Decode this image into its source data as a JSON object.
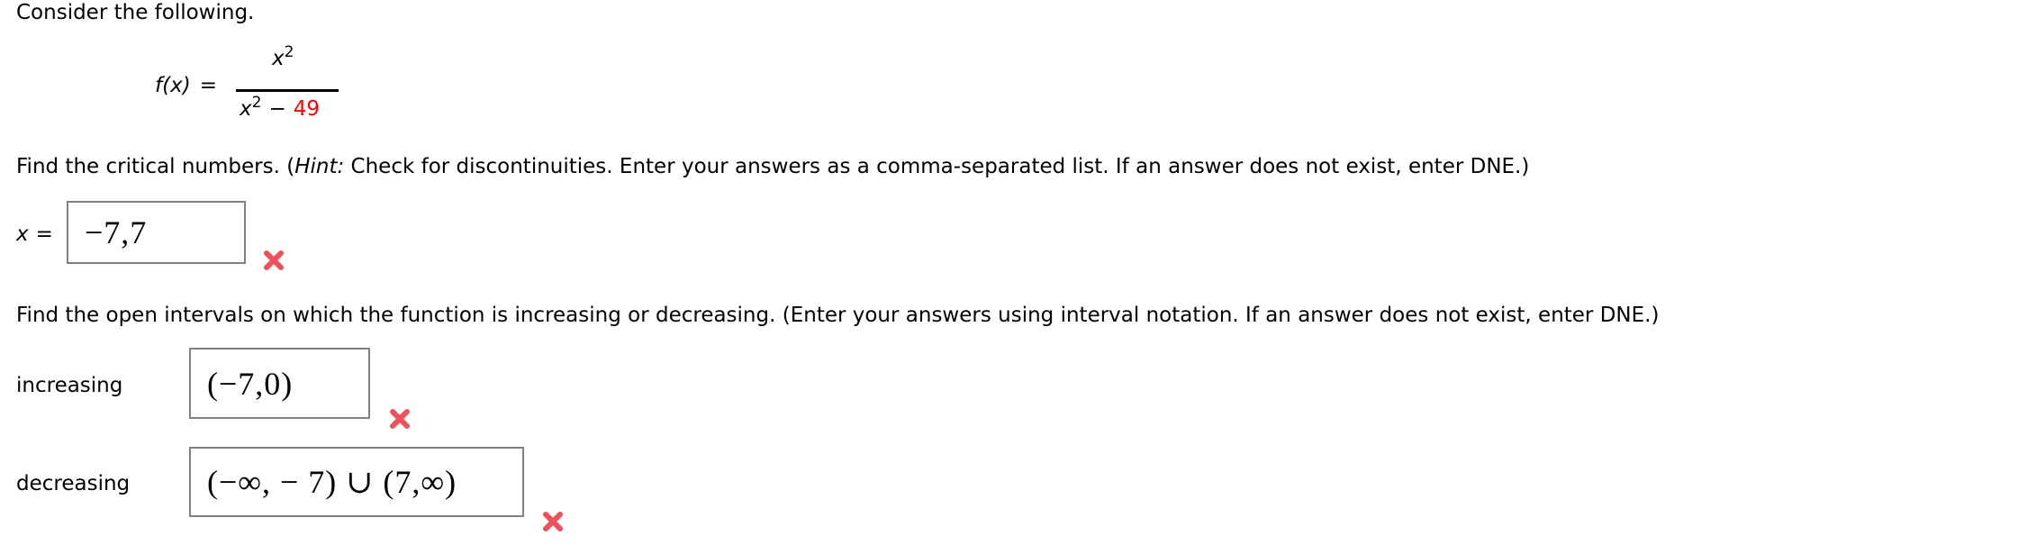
{
  "intro": "Consider the following.",
  "function": {
    "lhs_name": "f",
    "lhs_var": "x",
    "equals": "=",
    "numerator_var": "x",
    "numerator_exp": "2",
    "denominator_var": "x",
    "denominator_exp": "2",
    "denominator_op": "−",
    "denominator_const": "49",
    "highlight_color": "#ff0000"
  },
  "question1": {
    "text_before_hint": "Find the critical numbers. (",
    "hint_label": "Hint:",
    "text_after_hint": " Check for discontinuities. Enter your answers as a comma-separated list. If an answer does not exist, enter DNE.)",
    "answer_label_var": "x",
    "answer_label_eq": "=",
    "answer_value": "−7,7",
    "status": "incorrect",
    "status_icon": "red-x-icon"
  },
  "question2": {
    "text": "Find the open intervals on which the function is increasing or decreasing. (Enter your answers using interval notation. If an answer does not exist, enter DNE.)",
    "rows": [
      {
        "label": "increasing",
        "answer_value": "(−7,0)",
        "status": "incorrect",
        "status_icon": "red-x-icon"
      },
      {
        "label": "decreasing",
        "answer_value": "(−∞, − 7) ∪ (7,∞)",
        "status": "incorrect",
        "status_icon": "red-x-icon"
      }
    ]
  },
  "colors": {
    "incorrect": "#f0505a",
    "input_border": "#808080"
  }
}
